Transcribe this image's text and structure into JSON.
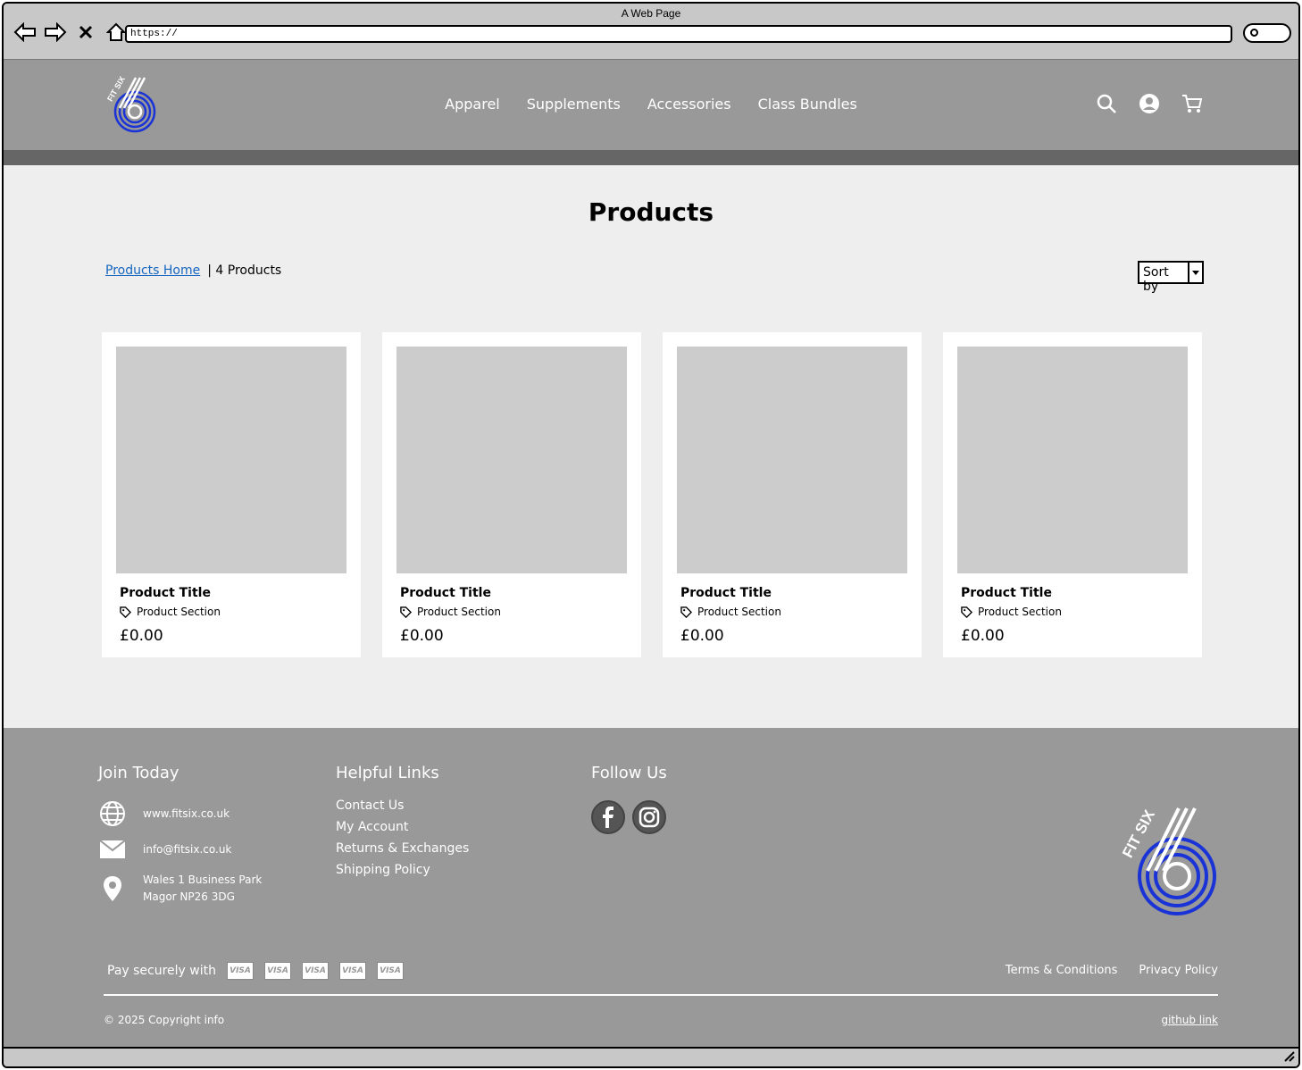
{
  "browser": {
    "title": "A Web Page",
    "url": "https://"
  },
  "header": {
    "nav": [
      "Apparel",
      "Supplements",
      "Accessories",
      "Class Bundles"
    ],
    "logo_text": "FIT SIX"
  },
  "main": {
    "title": "Products",
    "breadcrumb_link": "Products Home",
    "count_text": "| 4 Products",
    "sort_label": "Sort by",
    "products": [
      {
        "title": "Product Title",
        "section": "Product Section",
        "price": "£0.00"
      },
      {
        "title": "Product Title",
        "section": "Product Section",
        "price": "£0.00"
      },
      {
        "title": "Product Title",
        "section": "Product Section",
        "price": "£0.00"
      },
      {
        "title": "Product Title",
        "section": "Product Section",
        "price": "£0.00"
      }
    ]
  },
  "footer": {
    "join_heading": "Join Today",
    "website": "www.fitsix.co.uk",
    "email": "info@fitsix.co.uk",
    "address_line1": "Wales 1 Business Park",
    "address_line2": "Magor NP26 3DG",
    "links_heading": "Helpful Links",
    "links": [
      "Contact Us",
      "My Account",
      "Returns & Exchanges",
      "Shipping Policy"
    ],
    "follow_heading": "Follow Us",
    "pay_text": "Pay securely with",
    "card_label": "VISA",
    "terms": "Terms & Conditions",
    "privacy": "Privacy Policy",
    "copyright": "© 2025 Copyright info",
    "github": "github link"
  },
  "colors": {
    "header_bg": "#999999",
    "main_bg": "#eeeeee",
    "link_blue": "#1565c0",
    "logo_blue": "#1a33d6"
  }
}
